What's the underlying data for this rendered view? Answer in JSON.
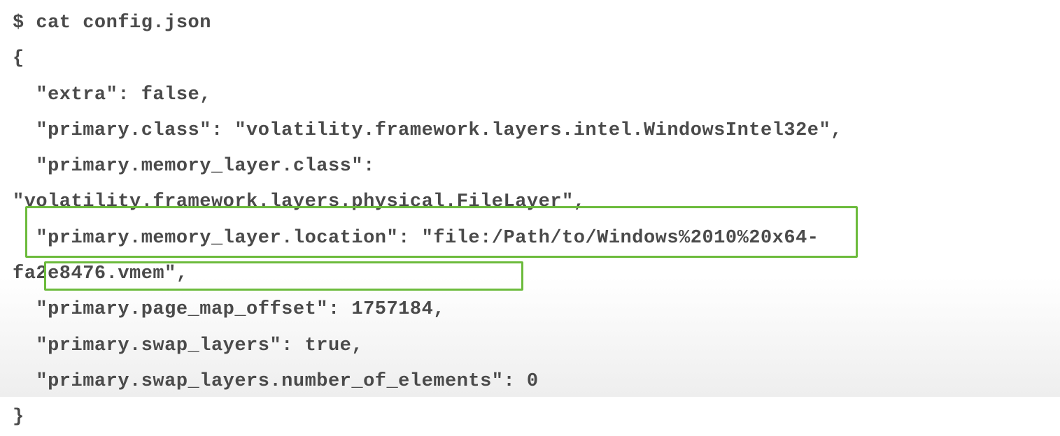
{
  "terminal": {
    "command": "$ cat config.json",
    "open_brace": "{",
    "close_brace": "}",
    "lines": {
      "l1": "  \"extra\": false,",
      "l2": "  \"primary.class\": \"volatility.framework.layers.intel.WindowsIntel32e\",",
      "l3a": "  \"primary.memory_layer.class\":",
      "l3b": "\"volatility.framework.layers.physical.FileLayer\",",
      "l4a": "  \"primary.memory_layer.location\": \"file:/Path/to/Windows%2010%20x64-",
      "l4b": "fa2e8476.vmem\",",
      "l5": "  \"primary.page_map_offset\": 1757184,",
      "l6": "  \"primary.swap_layers\": true,",
      "l7": "  \"primary.swap_layers.number_of_elements\": 0"
    }
  }
}
